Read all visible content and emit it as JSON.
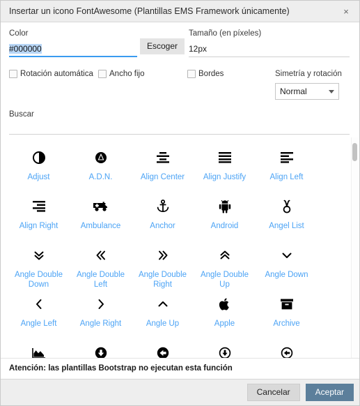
{
  "titlebar": {
    "title": "Insertar un icono FontAwesome (Plantillas EMS Framework únicamente)",
    "close_label": "×"
  },
  "form": {
    "color_label": "Color",
    "color_value": "#000000",
    "pick_button": "Escoger",
    "size_label": "Tamaño (en píxeles)",
    "size_value": "12px",
    "checkboxes": [
      {
        "label": "Rotación automática",
        "checked": false
      },
      {
        "label": "Ancho fijo",
        "checked": false
      },
      {
        "label": "Bordes",
        "checked": false
      }
    ],
    "symmetry_label": "Simetría y rotación",
    "symmetry_value": "Normal",
    "search_label": "Buscar",
    "search_value": ""
  },
  "icons": [
    {
      "label": "Adjust",
      "name": "adjust-icon"
    },
    {
      "label": "A.D.N.",
      "name": "adn-icon"
    },
    {
      "label": "Align Center",
      "name": "align-center-icon"
    },
    {
      "label": "Align Justify",
      "name": "align-justify-icon"
    },
    {
      "label": "Align Left",
      "name": "align-left-icon"
    },
    {
      "label": "Align Right",
      "name": "align-right-icon"
    },
    {
      "label": "Ambulance",
      "name": "ambulance-icon"
    },
    {
      "label": "Anchor",
      "name": "anchor-icon"
    },
    {
      "label": "Android",
      "name": "android-icon"
    },
    {
      "label": "Angel List",
      "name": "angellist-icon"
    },
    {
      "label": "Angle Double Down",
      "name": "angle-double-down-icon"
    },
    {
      "label": "Angle Double Left",
      "name": "angle-double-left-icon"
    },
    {
      "label": "Angle Double Right",
      "name": "angle-double-right-icon"
    },
    {
      "label": "Angle Double Up",
      "name": "angle-double-up-icon"
    },
    {
      "label": "Angle Down",
      "name": "angle-down-icon"
    },
    {
      "label": "Angle Left",
      "name": "angle-left-icon"
    },
    {
      "label": "Angle Right",
      "name": "angle-right-icon"
    },
    {
      "label": "Angle Up",
      "name": "angle-up-icon"
    },
    {
      "label": "Apple",
      "name": "apple-icon"
    },
    {
      "label": "Archive",
      "name": "archive-icon"
    },
    {
      "label": "",
      "name": "area-chart-icon"
    },
    {
      "label": "",
      "name": "arrow-circle-down-icon"
    },
    {
      "label": "",
      "name": "arrow-circle-left-icon"
    },
    {
      "label": "",
      "name": "arrow-circle-o-down-icon"
    },
    {
      "label": "",
      "name": "arrow-circle-o-left-icon"
    }
  ],
  "footer": {
    "warning": "Atención: las plantillas Bootstrap no ejecutan esta función",
    "cancel_label": "Cancelar",
    "accept_label": "Aceptar"
  },
  "colors": {
    "link": "#4ba3f5",
    "accent": "#3a9bf0",
    "accept_button": "#5c7f9b",
    "titlebar": "#eeeeee"
  }
}
